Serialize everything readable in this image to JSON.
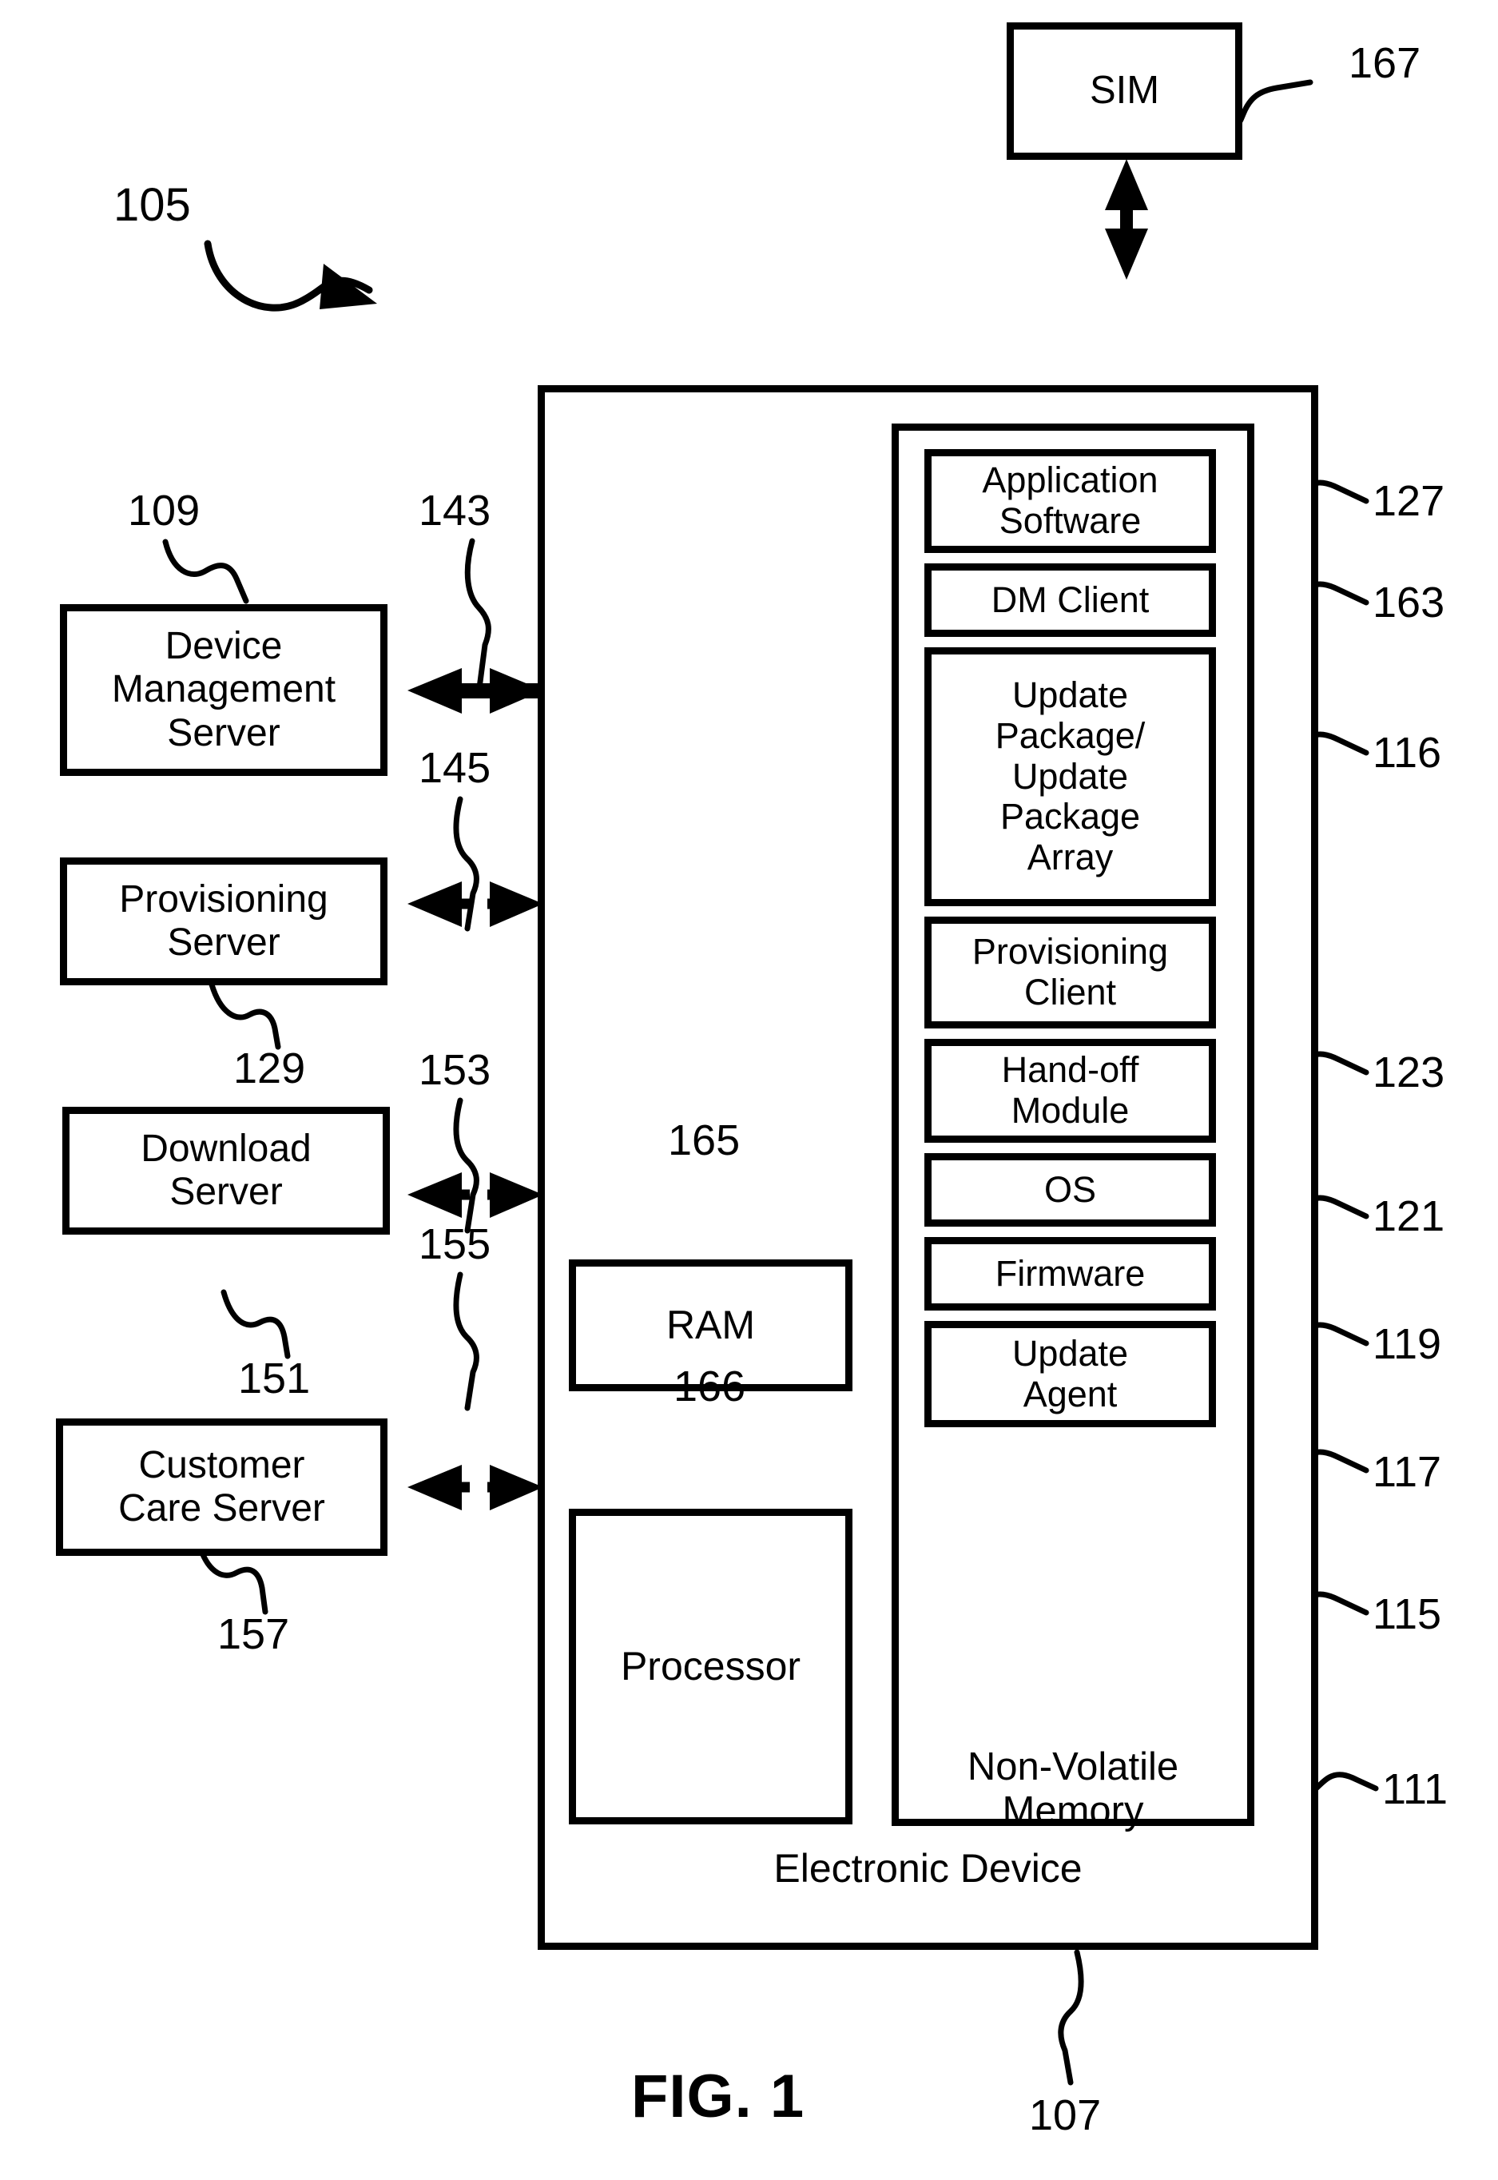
{
  "figure": {
    "title": "FIG. 1",
    "overall_ref": "105",
    "device_ref": "107"
  },
  "sim": {
    "label": "SIM",
    "ref": "167"
  },
  "servers": [
    {
      "label": "Device\nManagement\nServer",
      "ref": "109",
      "link_ref": "143",
      "link_style": "solid"
    },
    {
      "label": "Provisioning\nServer",
      "ref": "129",
      "link_ref": "145",
      "link_style": "dashed"
    },
    {
      "label": "Download\nServer",
      "ref": "151",
      "link_ref": "153",
      "link_style": "dashed"
    },
    {
      "label": "Customer\nCare Server",
      "ref": "157",
      "link_ref": "155",
      "link_style": "dashed"
    }
  ],
  "device": {
    "label": "Electronic Device",
    "ref": "107",
    "ram": {
      "label": "RAM",
      "ref": "165"
    },
    "processor": {
      "label": "Processor",
      "ref": "166"
    },
    "memory": {
      "label": "Non-Volatile\nMemory",
      "ref": "111",
      "items": [
        {
          "label": "Application\nSoftware",
          "ref": "127"
        },
        {
          "label": "DM Client",
          "ref": "163"
        },
        {
          "label": "Update\nPackage/\nUpdate\nPackage\nArray",
          "ref": "116"
        },
        {
          "label": "Provisioning\nClient",
          "ref": "123"
        },
        {
          "label": "Hand-off\nModule",
          "ref": "121"
        },
        {
          "label": "OS",
          "ref": "119"
        },
        {
          "label": "Firmware",
          "ref": "117"
        },
        {
          "label": "Update\nAgent",
          "ref": "115"
        }
      ]
    }
  },
  "colors": {
    "ink": "#000000",
    "paper": "#ffffff"
  }
}
